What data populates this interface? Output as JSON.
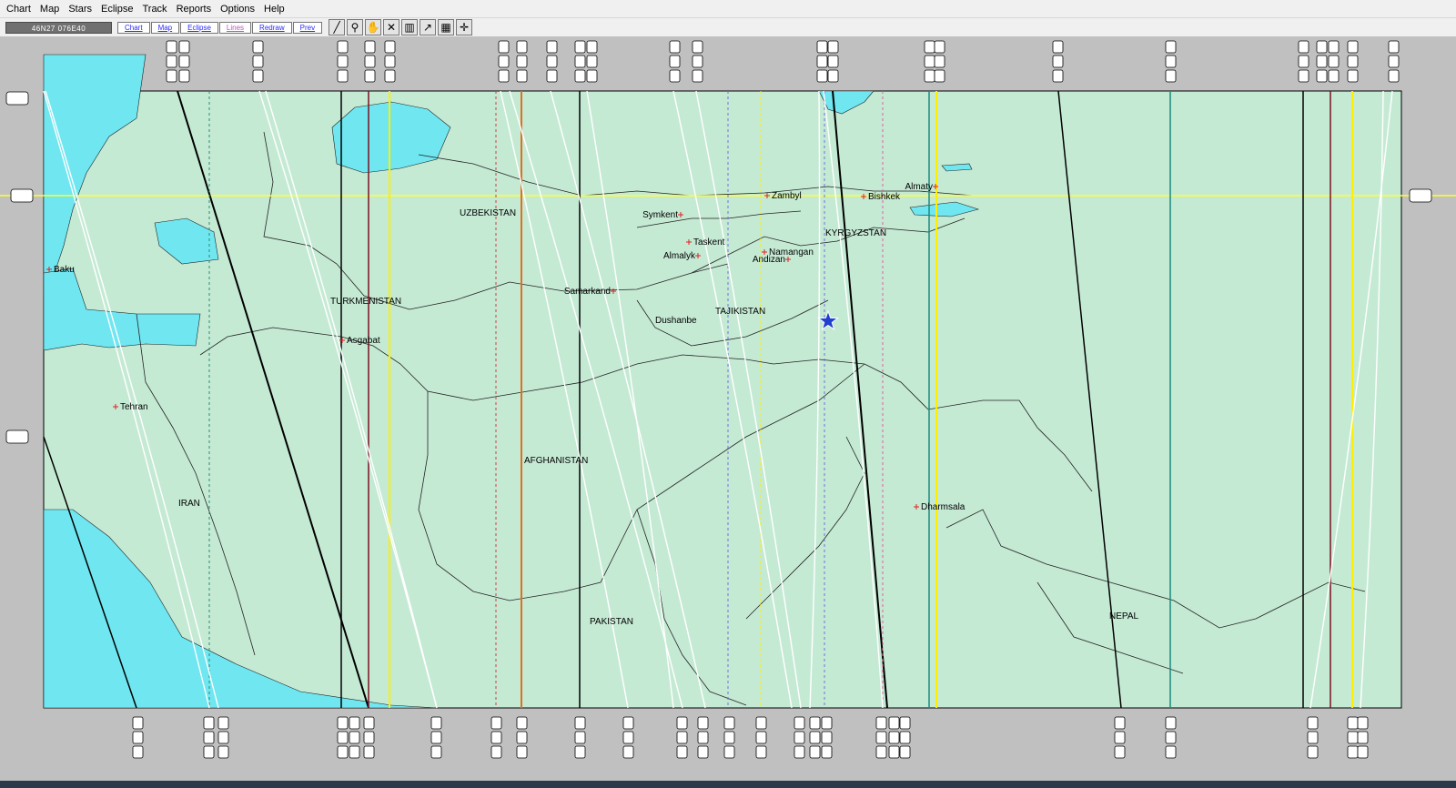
{
  "menu": [
    "Chart",
    "Map",
    "Stars",
    "Eclipse",
    "Track",
    "Reports",
    "Options",
    "Help"
  ],
  "toolbar": {
    "coordinates": "46N27  076E40",
    "buttons": [
      "Chart",
      "Map",
      "Eclipse",
      "Lines",
      "Redraw",
      "Prev"
    ],
    "tools": [
      "line-tool-icon",
      "zoom-icon",
      "hand-icon",
      "cross-icon",
      "column-icon",
      "arrow-grid-icon",
      "chart-grid-icon",
      "crosshair-icon"
    ]
  },
  "map": {
    "land_color": "#c5ead4",
    "water_color": "#6fe6f0",
    "frame_color": "#c0c0c0",
    "countries": [
      "UZBEKISTAN",
      "KYRGYZSTAN",
      "TURKMENISTAN",
      "TAJIKISTAN",
      "AFGHANISTAN",
      "IRAN",
      "PAKISTAN",
      "NEPAL"
    ],
    "cities": [
      "Baku",
      "Tehran",
      "Asgabat",
      "Samarkand",
      "Dushanbe",
      "Symkent",
      "Taskent",
      "Almalyk",
      "Namangan",
      "Andizan",
      "Zambyl",
      "Bishkek",
      "Almaty",
      "Dharmsala"
    ],
    "marker": "star-icon",
    "marker_color": "#2040d0"
  }
}
